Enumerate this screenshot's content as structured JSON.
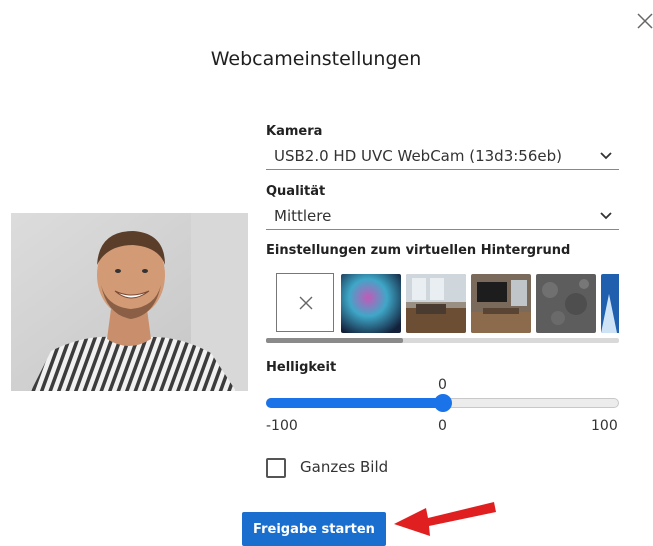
{
  "dialog": {
    "title": "Webcameinstellungen",
    "close_icon": "close-icon"
  },
  "camera": {
    "label": "Kamera",
    "selected": "USB2.0 HD UVC WebCam (13d3:56eb)"
  },
  "quality": {
    "label": "Qualität",
    "selected": "Mittlere"
  },
  "background": {
    "label": "Einstellungen zum virtuellen Hintergrund",
    "items": [
      {
        "name": "no-background",
        "icon": "close-icon"
      },
      {
        "name": "abstract-glow"
      },
      {
        "name": "living-room"
      },
      {
        "name": "meeting-room"
      },
      {
        "name": "office-space"
      },
      {
        "name": "gray-texture"
      },
      {
        "name": "blue-scene"
      }
    ]
  },
  "brightness": {
    "label": "Helligkeit",
    "value": "0",
    "min_label": "-100",
    "mid_label": "0",
    "max_label": "100",
    "value_fraction": 0.5
  },
  "full_image": {
    "label": "Ganzes Bild",
    "checked": false
  },
  "actions": {
    "start_label": "Freigabe starten"
  },
  "colors": {
    "accent": "#1a73e8",
    "button": "#1a6fce",
    "arrow": "#e02020"
  }
}
